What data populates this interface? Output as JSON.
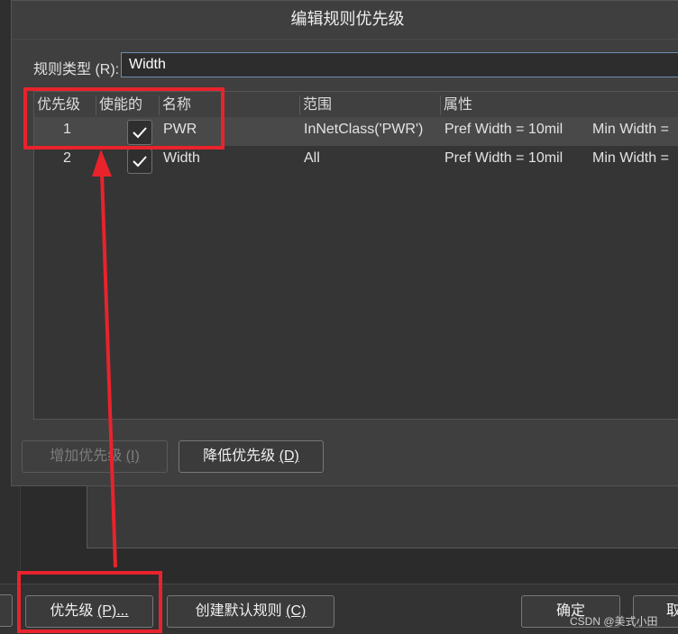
{
  "dialog": {
    "title": "编辑规则优先级",
    "rule_type_label": "规则类型",
    "rule_type_shortcut": "(R):",
    "rule_type_value": "Width"
  },
  "table": {
    "columns": [
      "优先级",
      "使能的",
      "名称",
      "范围",
      "属性"
    ],
    "rows": [
      {
        "priority": "1",
        "enabled": true,
        "name": "PWR",
        "scope": "InNetClass('PWR')",
        "prop1": "Pref Width =  10mil",
        "prop2": "Min Width ="
      },
      {
        "priority": "2",
        "enabled": true,
        "name": "Width",
        "scope": "All",
        "prop1": "Pref Width =  10mil",
        "prop2": "Min Width ="
      }
    ]
  },
  "buttons": {
    "increase_priority": "增加优先级",
    "increase_priority_key": "(I)",
    "decrease_priority": "降低优先级",
    "decrease_priority_key": "(D)",
    "priorities": "优先级",
    "priorities_key": "(P)...",
    "create_default_rules": "创建默认规则",
    "create_default_rules_key": "(C)",
    "ok": "确定",
    "cancel_partial": "取"
  },
  "watermark": "CSDN @美式小田",
  "colors": {
    "annotation_red": "#e8232c",
    "accent_blue": "#6e8fb0"
  }
}
